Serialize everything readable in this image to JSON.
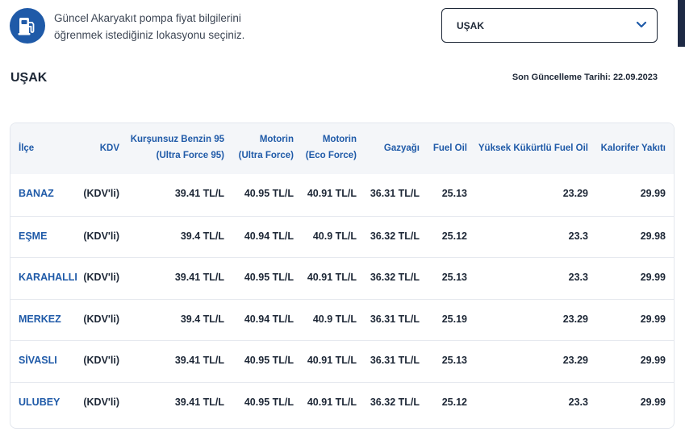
{
  "header": {
    "intro_line1": "Güncel Akaryakıt pompa fiyat bilgilerini",
    "intro_line2": "öğrenmek istediğiniz lokasyonu seçiniz.",
    "location_value": "UŞAK",
    "icon": "fuel-pump-icon",
    "accent": "#1f5aa8"
  },
  "city": {
    "title": "UŞAK",
    "updated": "Son Güncelleme Tarihi: 22.09.2023"
  },
  "table": {
    "headers": {
      "district": "İlçe",
      "kdv": "KDV",
      "benzin_l1": "Kurşunsuz Benzin 95",
      "benzin_l2": "(Ultra Force 95)",
      "motorin_ultra_l1": "Motorin",
      "motorin_ultra_l2": "(Ultra Force)",
      "motorin_eco_l1": "Motorin",
      "motorin_eco_l2": "(Eco Force)",
      "gazyagi": "Gazyağı",
      "fuel_oil": "Fuel Oil",
      "yuksek": "Yüksek Kükürtlü Fuel Oil",
      "kalorifer": "Kalorifer Yakıtı"
    },
    "rows": [
      {
        "district": "BANAZ",
        "kdv": "(KDV'li)",
        "benzin": "39.41 TL/L",
        "motorin_ultra": "40.95 TL/L",
        "motorin_eco": "40.91 TL/L",
        "gazyagi": "36.31 TL/L",
        "fuel_oil": "25.13",
        "yuksek": "23.29",
        "kalorifer": "29.99"
      },
      {
        "district": "EŞME",
        "kdv": "(KDV'li)",
        "benzin": "39.4 TL/L",
        "motorin_ultra": "40.94 TL/L",
        "motorin_eco": "40.9 TL/L",
        "gazyagi": "36.32 TL/L",
        "fuel_oil": "25.12",
        "yuksek": "23.3",
        "kalorifer": "29.98"
      },
      {
        "district": "KARAHALLI",
        "kdv": "(KDV'li)",
        "benzin": "39.41 TL/L",
        "motorin_ultra": "40.95 TL/L",
        "motorin_eco": "40.91 TL/L",
        "gazyagi": "36.32 TL/L",
        "fuel_oil": "25.13",
        "yuksek": "23.3",
        "kalorifer": "29.99"
      },
      {
        "district": "MERKEZ",
        "kdv": "(KDV'li)",
        "benzin": "39.4 TL/L",
        "motorin_ultra": "40.94 TL/L",
        "motorin_eco": "40.9 TL/L",
        "gazyagi": "36.31 TL/L",
        "fuel_oil": "25.19",
        "yuksek": "23.29",
        "kalorifer": "29.99"
      },
      {
        "district": "SİVASLI",
        "kdv": "(KDV'li)",
        "benzin": "39.41 TL/L",
        "motorin_ultra": "40.95 TL/L",
        "motorin_eco": "40.91 TL/L",
        "gazyagi": "36.31 TL/L",
        "fuel_oil": "25.13",
        "yuksek": "23.29",
        "kalorifer": "29.99"
      },
      {
        "district": "ULUBEY",
        "kdv": "(KDV'li)",
        "benzin": "39.41 TL/L",
        "motorin_ultra": "40.95 TL/L",
        "motorin_eco": "40.91 TL/L",
        "gazyagi": "36.32 TL/L",
        "fuel_oil": "25.12",
        "yuksek": "23.3",
        "kalorifer": "29.99"
      }
    ]
  }
}
